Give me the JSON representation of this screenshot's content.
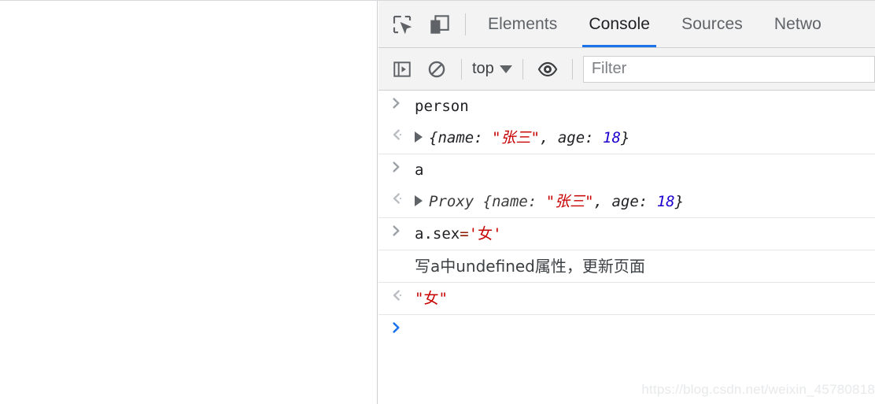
{
  "devtools": {
    "toolbar_icons": [
      {
        "name": "inspect-element-icon",
        "title": "Inspect element"
      },
      {
        "name": "device-toolbar-icon",
        "title": "Toggle device toolbar"
      }
    ],
    "tabs": [
      {
        "label": "Elements",
        "active": false
      },
      {
        "label": "Console",
        "active": true
      },
      {
        "label": "Sources",
        "active": false
      },
      {
        "label": "Netwo",
        "active": false
      }
    ],
    "console_toolbar": {
      "sidebar_toggle_icon": "console-sidebar-icon",
      "clear_console_icon": "clear-console-icon",
      "context_label": "top",
      "context_caret_icon": "chevron-down-icon",
      "eye_icon": "live-expression-eye-icon",
      "filter_placeholder": "Filter"
    },
    "messages": [
      {
        "kind": "input",
        "gutter": "input-chevron-icon",
        "parts": [
          {
            "t": "person",
            "c": "plain"
          }
        ]
      },
      {
        "kind": "output",
        "gutter": "output-chevron-icon",
        "expandable": true,
        "parts": [
          {
            "t": "{name: ",
            "c": "plain"
          },
          {
            "t": "\"张三\"",
            "c": "str"
          },
          {
            "t": ", age: ",
            "c": "plain"
          },
          {
            "t": "18",
            "c": "num"
          },
          {
            "t": "}",
            "c": "plain"
          }
        ]
      },
      {
        "kind": "input",
        "gutter": "input-chevron-icon",
        "parts": [
          {
            "t": "a",
            "c": "plain"
          }
        ]
      },
      {
        "kind": "output",
        "gutter": "output-chevron-icon",
        "expandable": true,
        "parts": [
          {
            "t": "Proxy {name: ",
            "c": "plain"
          },
          {
            "t": "\"张三\"",
            "c": "str"
          },
          {
            "t": ", age: ",
            "c": "plain"
          },
          {
            "t": "18",
            "c": "num"
          },
          {
            "t": "}",
            "c": "plain"
          }
        ]
      },
      {
        "kind": "input",
        "gutter": "input-chevron-icon",
        "parts": [
          {
            "t": "a.sex",
            "c": "plain"
          },
          {
            "t": "=",
            "c": "op"
          },
          {
            "t": "'女'",
            "c": "str"
          }
        ]
      },
      {
        "kind": "log",
        "gutter": "",
        "parts": [
          {
            "t": "写a中undefined属性，更新页面",
            "c": "log"
          }
        ]
      },
      {
        "kind": "output",
        "gutter": "output-chevron-icon",
        "expandable": false,
        "parts": [
          {
            "t": "\"女\"",
            "c": "str"
          }
        ]
      }
    ],
    "prompt": {
      "gutter": "prompt-chevron-icon",
      "value": ""
    },
    "watermark": "https://blog.csdn.net/weixin_45780818"
  },
  "colors": {
    "accent": "#1a73e8",
    "string": "#c80000",
    "number": "#1c00cf",
    "operator": "#8b1a00",
    "chrome_bg": "#f3f3f3",
    "text": "#202124"
  }
}
